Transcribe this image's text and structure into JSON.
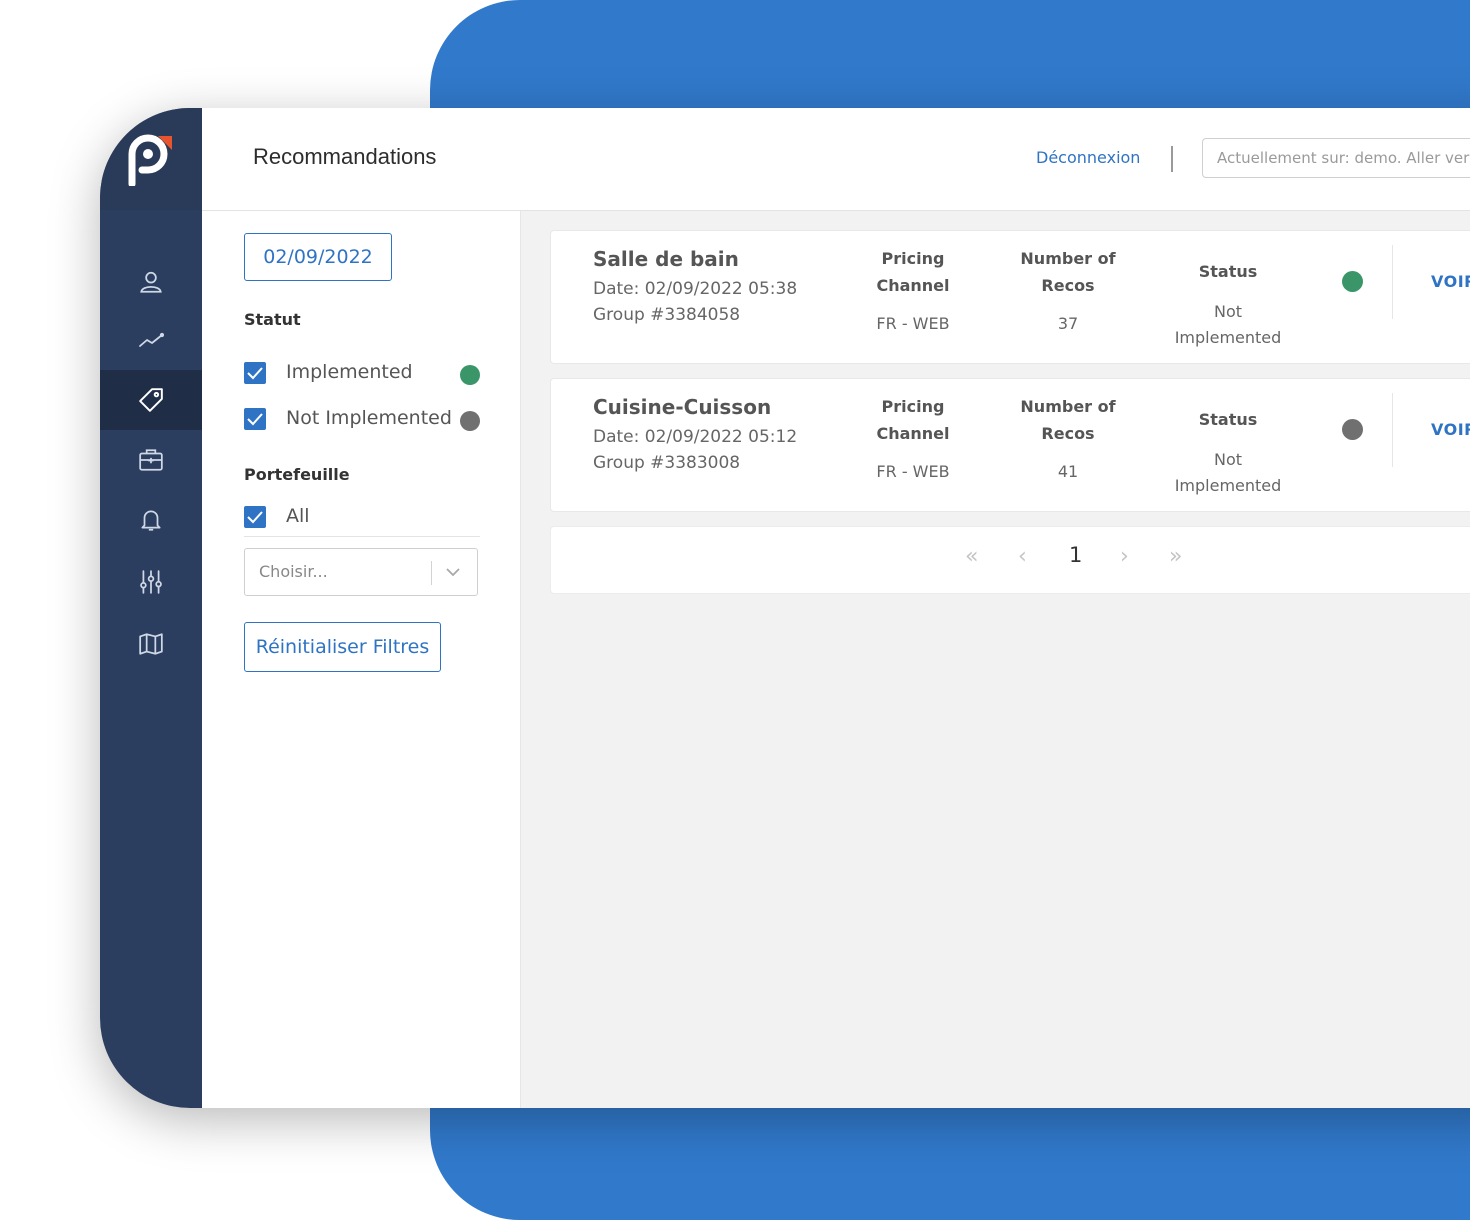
{
  "header": {
    "title": "Recommandations",
    "logout_label": "Déconnexion",
    "site_value": "Actuellement sur: demo. Aller vers..."
  },
  "sidebar": {
    "items": [
      {
        "icon": "user-icon"
      },
      {
        "icon": "trend-chart-icon"
      },
      {
        "icon": "tag-icon",
        "active": true
      },
      {
        "icon": "briefcase-icon"
      },
      {
        "icon": "bell-icon"
      },
      {
        "icon": "sliders-icon"
      },
      {
        "icon": "map-icon"
      }
    ]
  },
  "filters": {
    "date": "02/09/2022",
    "statut_label": "Statut",
    "statut_options": [
      {
        "label": "Implemented",
        "checked": true,
        "dot_color": "#3a9668"
      },
      {
        "label": "Not Implemented",
        "checked": true,
        "dot_color": "#707070"
      }
    ],
    "portefeuille_label": "Portefeuille",
    "portefeuille_all": "All",
    "select_placeholder": "Choisir...",
    "reset_label": "Réinitialiser Filtres"
  },
  "cards": [
    {
      "title": "Salle de bain",
      "date": "Date: 02/09/2022 05:38",
      "group": "Group #3384058",
      "channel_head_1": "Pricing",
      "channel_head_2": "Channel",
      "channel_value": "FR - WEB",
      "recos_head_1": "Number of",
      "recos_head_2": "Recos",
      "recos_value": "37",
      "status_head": "Status",
      "status_value_1": "Not",
      "status_value_2": "Implemented",
      "dot_color": "#3a9668",
      "action": "VOIR"
    },
    {
      "title": "Cuisine-Cuisson",
      "date": "Date: 02/09/2022 05:12",
      "group": "Group #3383008",
      "channel_head_1": "Pricing",
      "channel_head_2": "Channel",
      "channel_value": "FR - WEB",
      "recos_head_1": "Number of",
      "recos_head_2": "Recos",
      "recos_value": "41",
      "status_head": "Status",
      "status_value_1": "Not",
      "status_value_2": "Implemented",
      "dot_color": "#707070",
      "action": "VOIR"
    }
  ],
  "pagination": {
    "first": "«",
    "prev": "‹",
    "current": "1",
    "next": "›",
    "last": "»"
  },
  "colors": {
    "brand_blue": "#3179cb",
    "sidebar": "#2c3e5f",
    "implemented": "#3a9668",
    "not_implemented": "#707070"
  }
}
